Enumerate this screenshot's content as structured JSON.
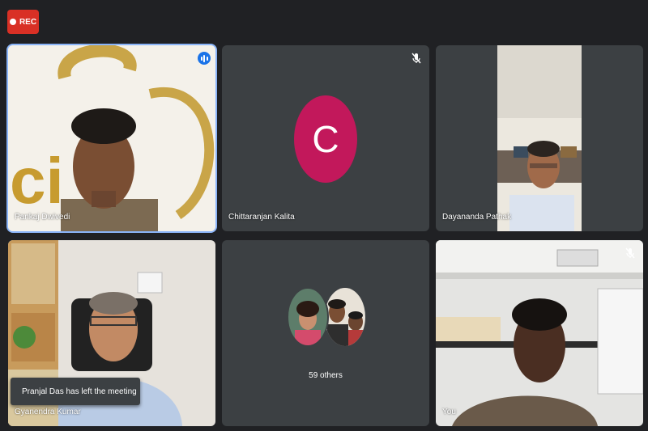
{
  "recording": {
    "label": "REC"
  },
  "participants": [
    {
      "name": "Pankaj Dwivedi"
    },
    {
      "name": "Chittaranjan Kalita",
      "avatar_letter": "C",
      "avatar_color": "#c2185b"
    },
    {
      "name": "Dayananda Pathak"
    },
    {
      "name": "Gyanendra Kumar"
    },
    {
      "others_label": "59 others"
    },
    {
      "name": "You"
    }
  ],
  "notification": {
    "text": "Pranjal Das has left the meeting"
  },
  "colors": {
    "background": "#202124",
    "tile": "#3c4043",
    "rec": "#d93025",
    "active_border": "#8ab4f8"
  }
}
